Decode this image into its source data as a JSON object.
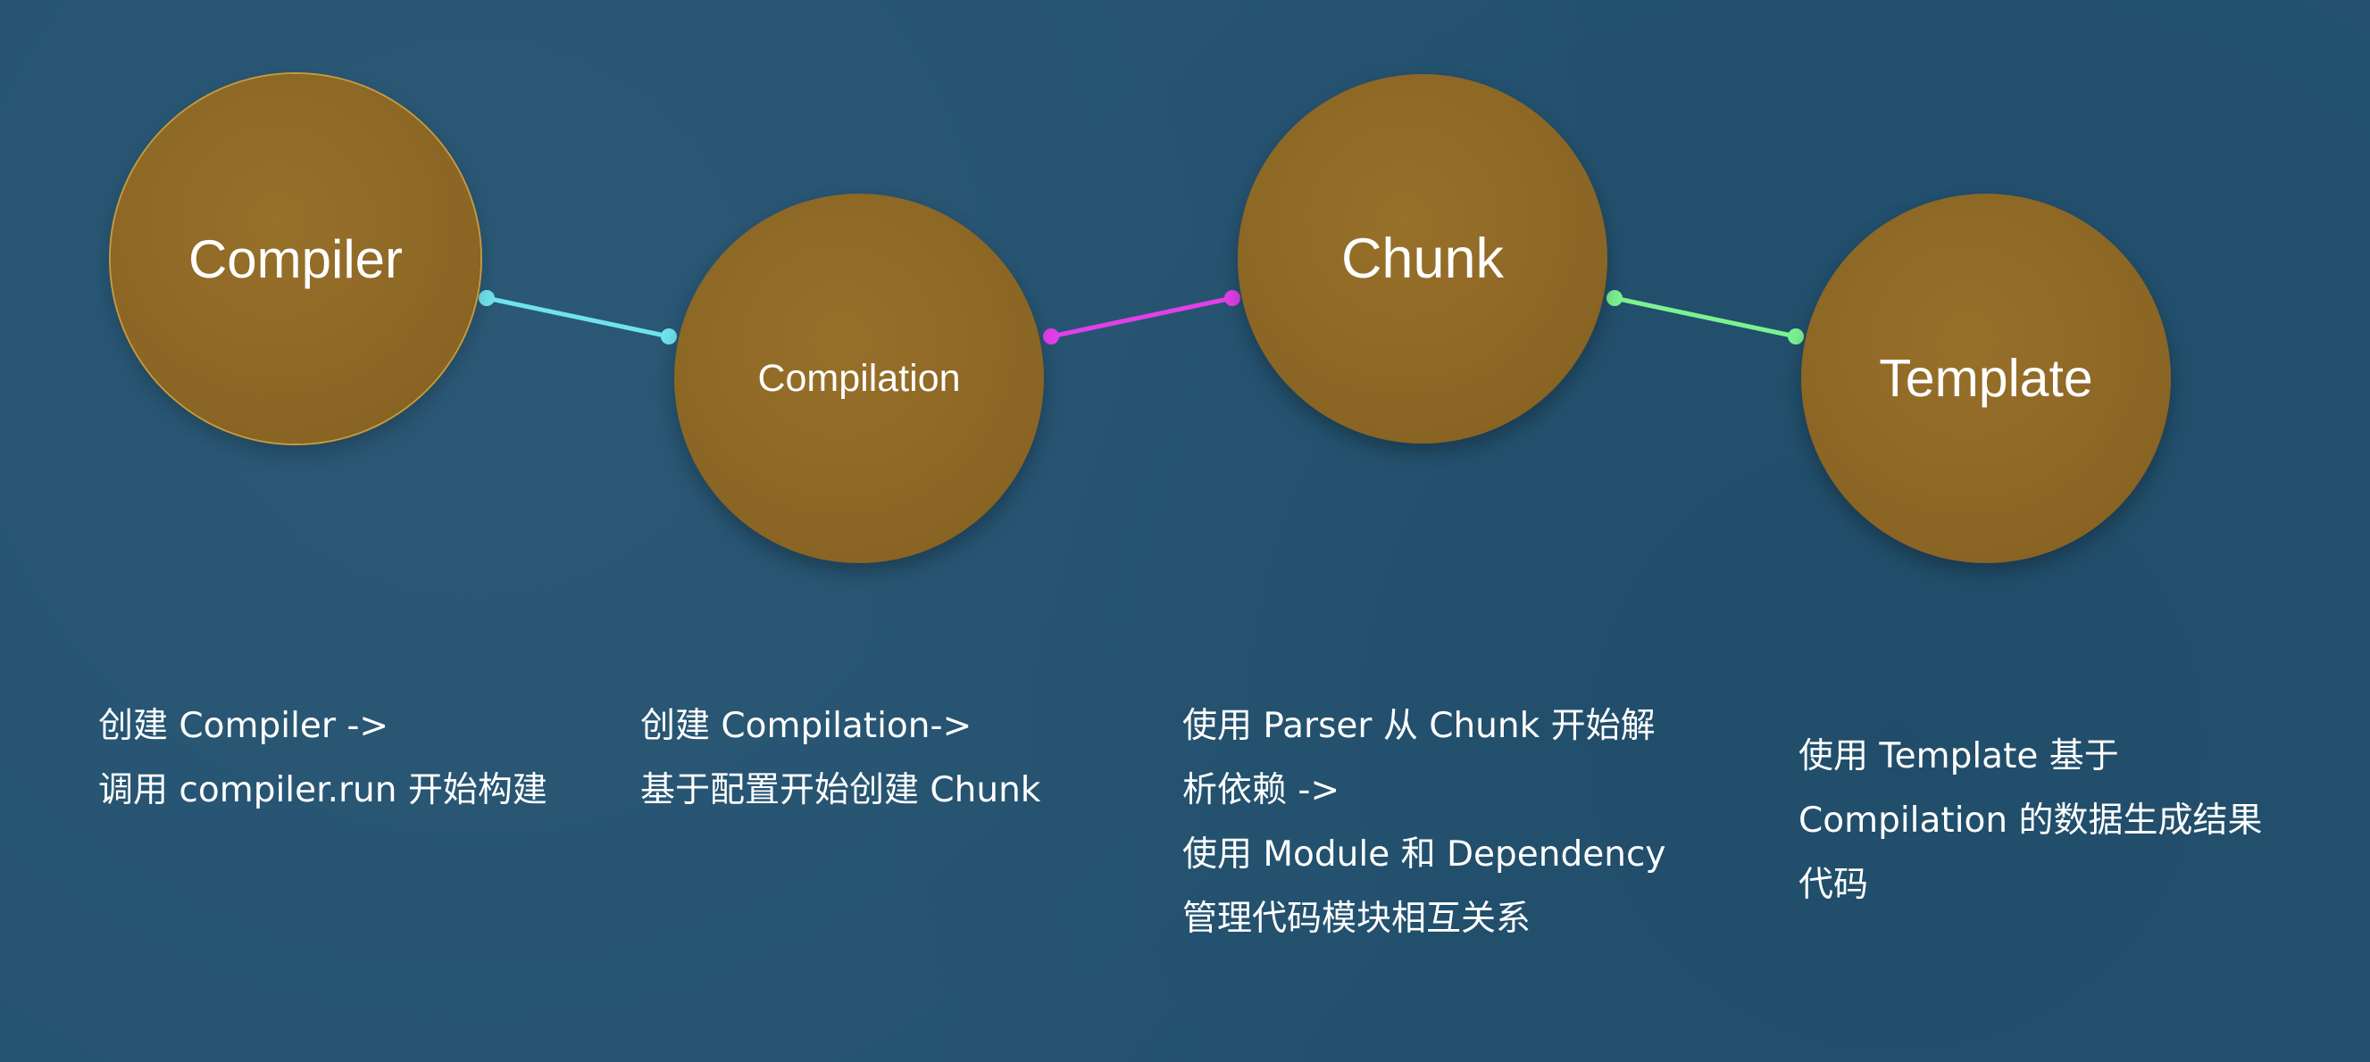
{
  "nodes": [
    {
      "id": "compiler",
      "label": "Compiler"
    },
    {
      "id": "compilation",
      "label": "Compilation"
    },
    {
      "id": "chunk",
      "label": "Chunk"
    },
    {
      "id": "template",
      "label": "Template"
    }
  ],
  "connectors": [
    {
      "from": "compiler",
      "to": "compilation",
      "color": "#6fe3ee"
    },
    {
      "from": "compilation",
      "to": "chunk",
      "color": "#e33fe8"
    },
    {
      "from": "chunk",
      "to": "template",
      "color": "#7cf291"
    }
  ],
  "descriptions": [
    {
      "node": "compiler",
      "lines": [
        "创建 Compiler ->",
        "调用 compiler.run 开始构建"
      ]
    },
    {
      "node": "compilation",
      "lines": [
        "创建 Compilation->",
        "基于配置开始创建 Chunk"
      ]
    },
    {
      "node": "chunk",
      "lines": [
        "使用 Parser 从 Chunk 开始解",
        "析依赖 ->",
        "使用 Module 和 Dependency",
        "管理代码模块相互关系"
      ]
    },
    {
      "node": "template",
      "lines": [
        "使用 Template 基于",
        "Compilation 的数据生成结果",
        "代码"
      ]
    }
  ],
  "colors": {
    "background": "#235270",
    "node_fill": "#8c6624",
    "text": "#ffffff"
  }
}
